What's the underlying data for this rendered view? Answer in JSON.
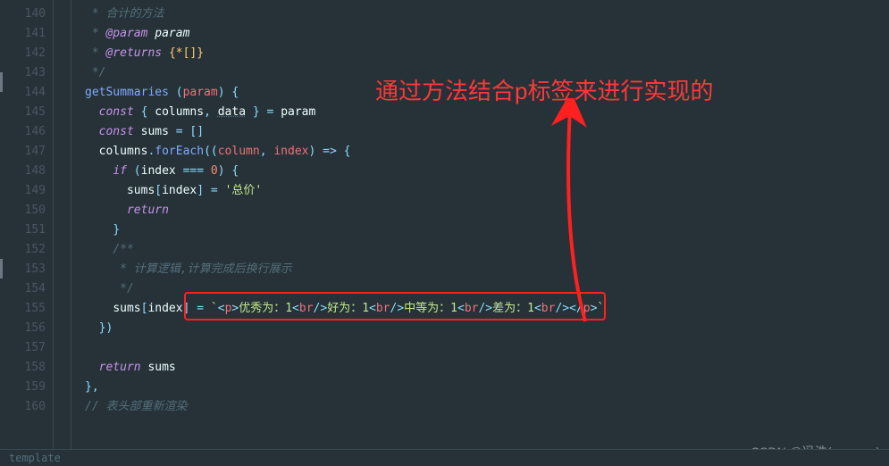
{
  "gutter": {
    "start": 140,
    "end": 160
  },
  "code": {
    "l140": " * 合计的方法",
    "l141_tag": "@param",
    "l141_name": "param",
    "l142_tag": "@returns",
    "l142_type": "{*[]}",
    "l143": " */",
    "l144_fn": "getSummaries",
    "l144_param": "param",
    "l145_const": "const",
    "l145_columns": "columns",
    "l145_data": "data",
    "l145_param": "param",
    "l146_const": "const",
    "l146_sums": "sums",
    "l147_columns": "columns",
    "l147_foreach": "forEach",
    "l147_column": "column",
    "l147_index": "index",
    "l148_if": "if",
    "l148_index": "index",
    "l148_zero": "0",
    "l149_sums": "sums",
    "l149_index": "index",
    "l149_str": "'总价'",
    "l150_return": "return",
    "l152": "/**",
    "l153": " * 计算逻辑,计算完成后换行展示",
    "l154": " */",
    "l155_sums": "sums",
    "l155_index": "index",
    "l155_html": "<p>优秀为：1<br/>好为：1<br/>中等为：1<br/>差为：1<br/></p>",
    "l158_return": "return",
    "l158_sums": "sums",
    "l160": "// 表头部重新渲染"
  },
  "annotation": {
    "text": "通过方法结合p标签来进行实现的",
    "watermark": "CSDN @冯浩(grow up)",
    "bottom_tab": "template"
  }
}
